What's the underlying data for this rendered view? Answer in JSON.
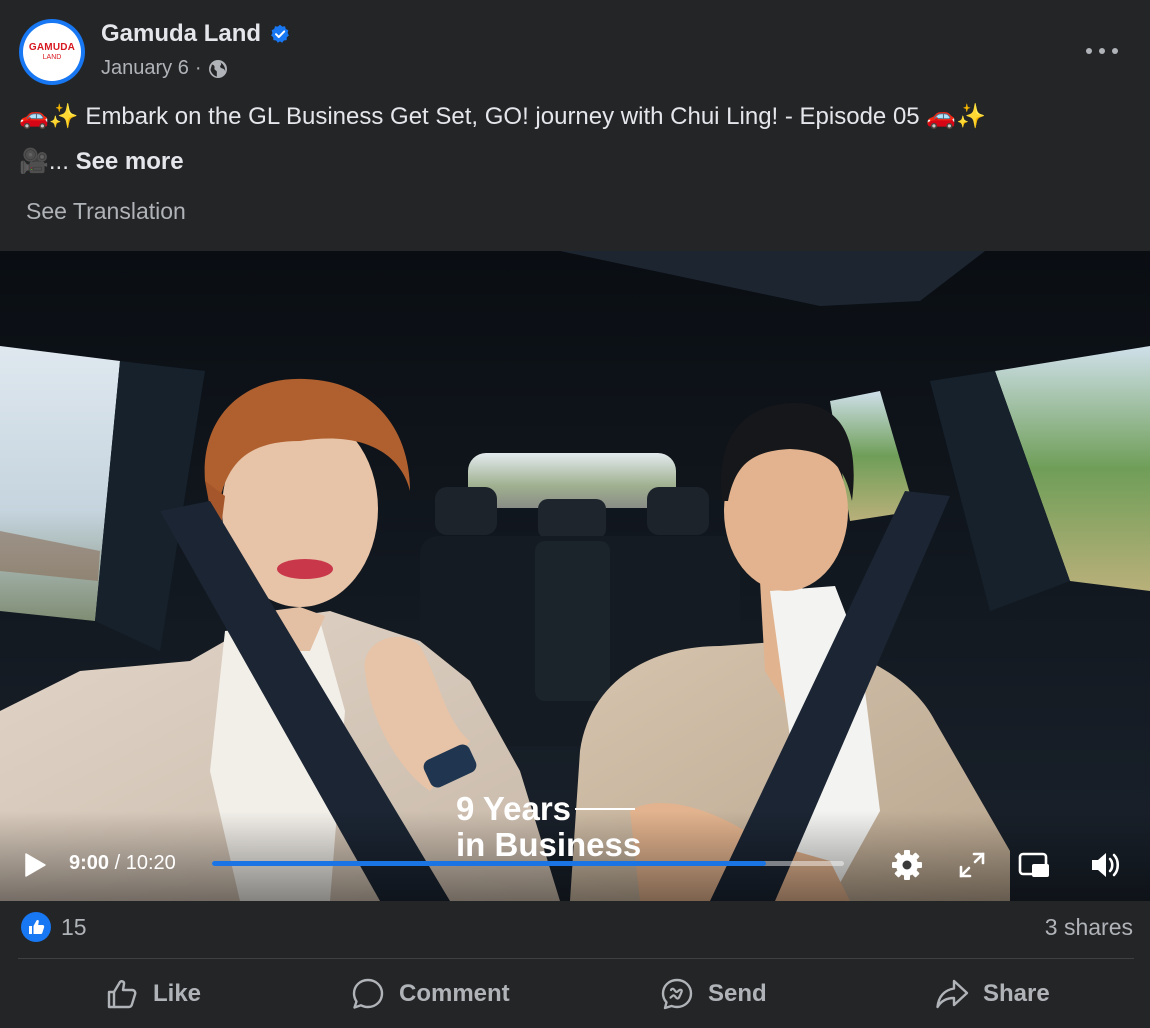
{
  "post": {
    "author": "Gamuda Land",
    "avatar_logo_top": "GAMUDA",
    "avatar_logo_bottom": "LAND",
    "date": "January 6",
    "date_separator": "·",
    "caption_line1": "🚗✨ Embark on the GL Business Get Set, GO! journey with Chui Ling! - Episode 05 🚗✨",
    "caption_line2_prefix": "🎥... ",
    "see_more_label": "See more",
    "see_translation_label": "See Translation"
  },
  "video": {
    "overlay_line1": "9 Years",
    "overlay_line2": "in Business",
    "current_time": "9:00",
    "time_separator": " / ",
    "duration": "10:20",
    "progress_fraction": 0.876
  },
  "reactions": {
    "count": "15",
    "shares": "3 shares"
  },
  "actions": {
    "like": "Like",
    "comment": "Comment",
    "send": "Send",
    "share": "Share"
  },
  "colors": {
    "accent": "#1877f2",
    "progress": "#1b74e4",
    "background": "#242526",
    "secondary_text": "#b0b3b8"
  },
  "icons": {
    "verified": "verified-badge-icon",
    "audience": "globe-icon",
    "more": "more-options-icon",
    "play": "play-icon",
    "settings": "gear-icon",
    "fullscreen": "expand-icon",
    "pip": "picture-in-picture-icon",
    "volume": "volume-icon",
    "like_badge": "thumbs-up-badge-icon",
    "like": "thumbs-up-icon",
    "comment": "comment-bubble-icon",
    "send": "messenger-icon",
    "share": "share-arrow-icon"
  }
}
